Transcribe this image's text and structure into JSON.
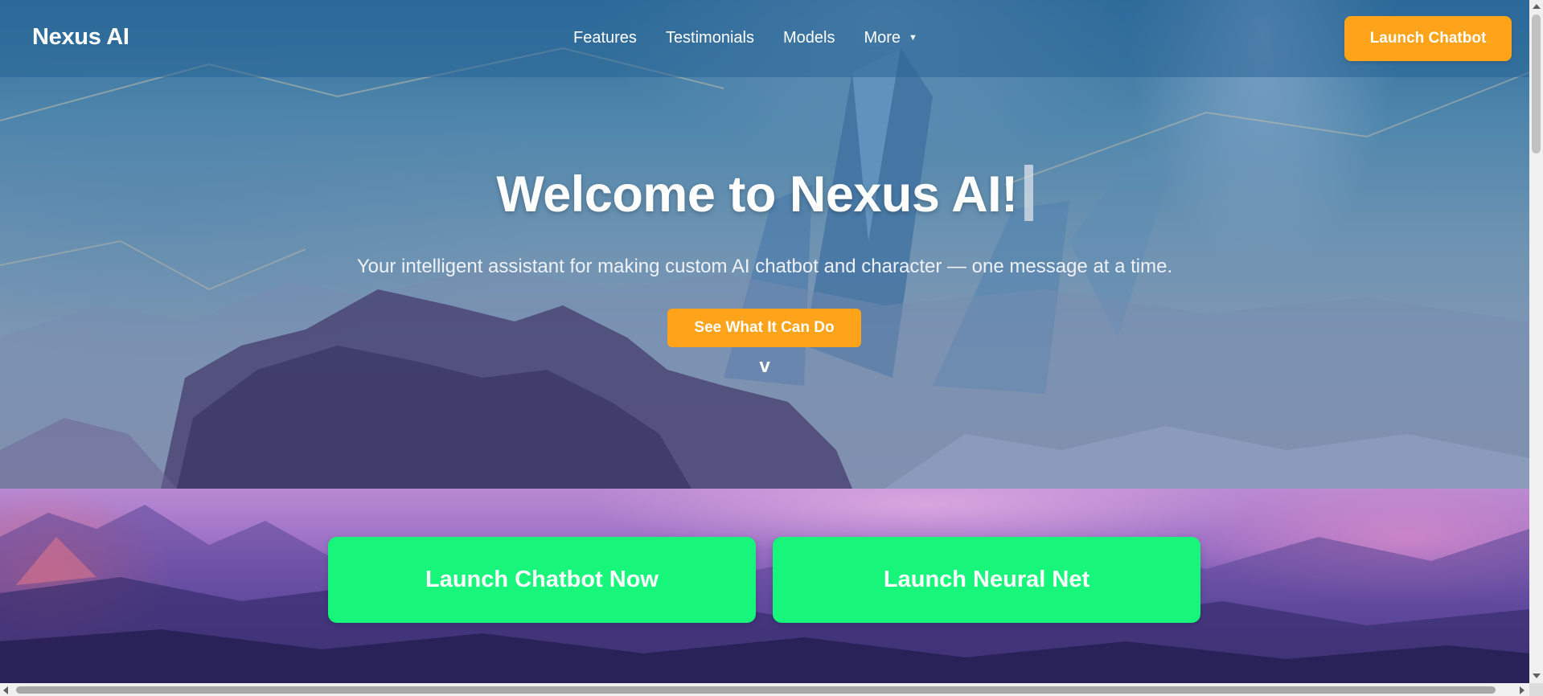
{
  "brand": {
    "logo": "Nexus AI"
  },
  "nav": {
    "items": [
      {
        "label": "Features"
      },
      {
        "label": "Testimonials"
      },
      {
        "label": "Models"
      },
      {
        "label": "More",
        "dropdown_icon": "caret-down-icon"
      }
    ],
    "launch_button": "Launch Chatbot"
  },
  "hero": {
    "title": "Welcome to Nexus AI!",
    "subtitle": "Your intelligent assistant for making custom AI chatbot and character — one message at a time.",
    "cta_label": "See What It Can Do",
    "scroll_hint": "v"
  },
  "actions": {
    "chatbot_label": "Launch Chatbot Now",
    "neural_label": "Launch Neural Net"
  },
  "colors": {
    "accent_orange": "#ffa31a",
    "accent_green": "#17f57a",
    "navbar": "#2f6f9c"
  }
}
